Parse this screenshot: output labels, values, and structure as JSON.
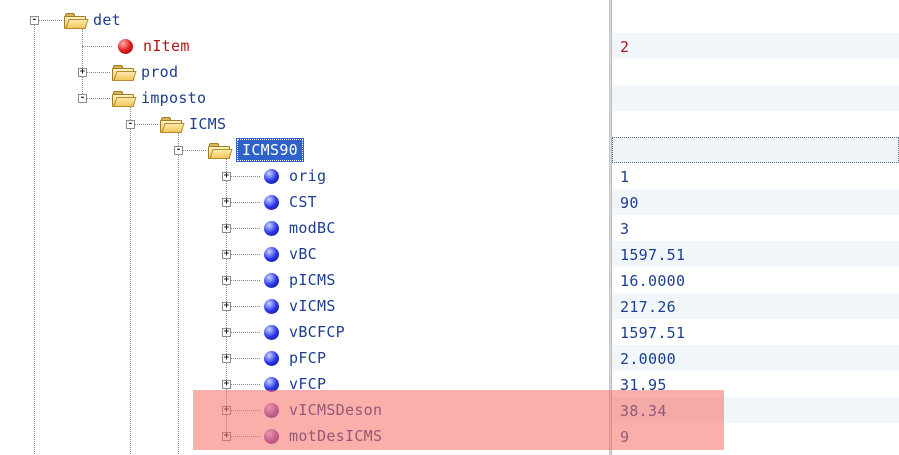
{
  "tree": {
    "nodes": [
      {
        "label": "det",
        "type": "folder"
      },
      {
        "label": "nItem",
        "type": "attribute",
        "value": "2"
      },
      {
        "label": "prod",
        "type": "folder"
      },
      {
        "label": "imposto",
        "type": "folder"
      },
      {
        "label": "ICMS",
        "type": "folder"
      },
      {
        "label": "ICMS90",
        "type": "folder",
        "selected": true
      },
      {
        "label": "orig",
        "type": "element",
        "value": "1"
      },
      {
        "label": "CST",
        "type": "element",
        "value": "90"
      },
      {
        "label": "modBC",
        "type": "element",
        "value": "3"
      },
      {
        "label": "vBC",
        "type": "element",
        "value": "1597.51"
      },
      {
        "label": "pICMS",
        "type": "element",
        "value": "16.0000"
      },
      {
        "label": "vICMS",
        "type": "element",
        "value": "217.26"
      },
      {
        "label": "vBCFCP",
        "type": "element",
        "value": "1597.51"
      },
      {
        "label": "pFCP",
        "type": "element",
        "value": "2.0000"
      },
      {
        "label": "vFCP",
        "type": "element",
        "value": "31.95"
      },
      {
        "label": "vICMSDeson",
        "type": "element",
        "value": "38.34"
      },
      {
        "label": "motDesICMS",
        "type": "element",
        "value": "9"
      }
    ]
  },
  "highlight": {
    "rows": [
      "vICMSDeson",
      "motDesICMS"
    ],
    "color": "#f56e64"
  },
  "colors": {
    "label": "#1d3f8f",
    "attribute_label": "#b01818",
    "selection": "#2f62c9",
    "row_shade": "#f1f6fb"
  }
}
